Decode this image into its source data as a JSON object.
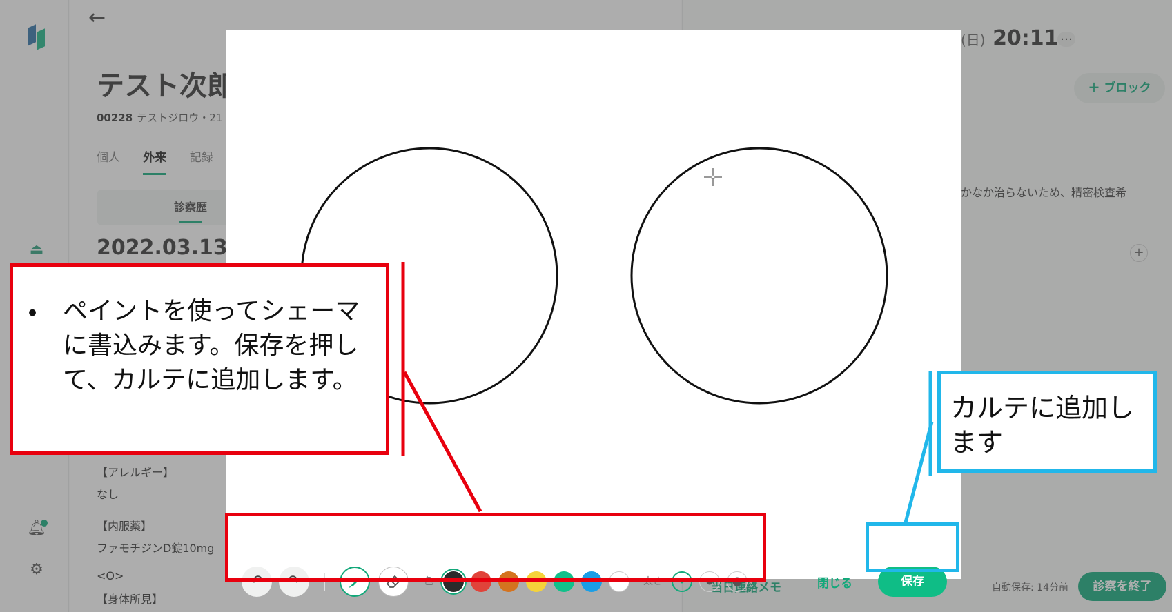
{
  "sidebar": {
    "logo": "app-logo",
    "icons": [
      "reception-bell-icon",
      "notification-bell-icon",
      "gear-icon"
    ]
  },
  "patient": {
    "name": "テスト次郎",
    "id": "00228",
    "kana": "テストジロウ・21",
    "tabs": [
      "個人",
      "外来",
      "記録"
    ],
    "active_tab": "外来",
    "history_tab": "診察歴",
    "visit_date": "2022.03.13",
    "visit_day": "(日",
    "allergy_label": "【アレルギー】",
    "allergy_value": "なし",
    "meds_label": "【内服薬】",
    "meds_value": "ファモチジンD錠10mg",
    "o_label": "<O>",
    "exam_label": "【身体所見】"
  },
  "right": {
    "time_day": "(日)",
    "time": "20:11",
    "more": "…",
    "add_block": "＋ ブロック",
    "note_text": "かなか治らないため、精密検査希",
    "add_plus": "+",
    "memo": "当日連絡メモ",
    "autosave": "自動保存: 14分前",
    "end_exam": "診察を終了"
  },
  "modal": {
    "toolbar": {
      "undo": "↶",
      "redo": "↷",
      "color_label": "色",
      "size_label": "太さ",
      "colors": [
        "#2b2b2b",
        "#e0433a",
        "#d4731f",
        "#f5d33a",
        "#11c08a",
        "#1a9ee6",
        "#ffffff"
      ],
      "selected_color": "#2b2b2b"
    },
    "close_label": "閉じる",
    "save_label": "保存"
  },
  "annotations": {
    "red_text": "ペイントを使ってシェーマに書込みます。保存を押して、カルテに追加します。",
    "red_bullet": "•",
    "blue_text": "カルテに追加します"
  },
  "colors": {
    "accent": "#12a87a",
    "annotation_red": "#e8000e",
    "annotation_blue": "#21b7ea"
  }
}
